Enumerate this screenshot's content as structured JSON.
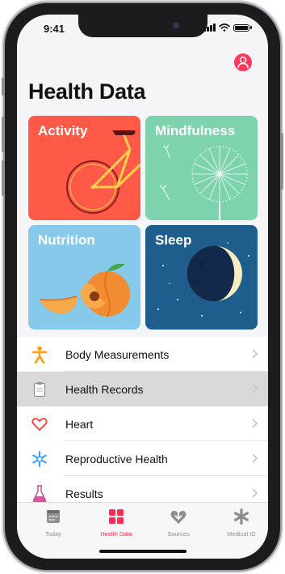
{
  "status_bar": {
    "time": "9:41"
  },
  "header": {
    "title": "Health Data"
  },
  "tiles": [
    {
      "label": "Activity",
      "color": "#ff5a47"
    },
    {
      "label": "Mindfulness",
      "color": "#7dd3ae"
    },
    {
      "label": "Nutrition",
      "color": "#86c9ea"
    },
    {
      "label": "Sleep",
      "color": "#1e5d8c"
    }
  ],
  "list": {
    "items": [
      {
        "label": "Body Measurements",
        "icon": "person-icon"
      },
      {
        "label": "Health Records",
        "icon": "clipboard-icon"
      },
      {
        "label": "Heart",
        "icon": "heart-icon"
      },
      {
        "label": "Reproductive Health",
        "icon": "snowflake-icon"
      },
      {
        "label": "Results",
        "icon": "flask-icon"
      }
    ]
  },
  "tabbar": {
    "items": [
      {
        "label": "Today",
        "icon": "calendar-icon"
      },
      {
        "label": "Health Data",
        "icon": "grid-icon"
      },
      {
        "label": "Sources",
        "icon": "sources-icon"
      },
      {
        "label": "Medical ID",
        "icon": "asterisk-icon"
      }
    ],
    "active": "Health Data",
    "accent": "#ff2d55"
  }
}
